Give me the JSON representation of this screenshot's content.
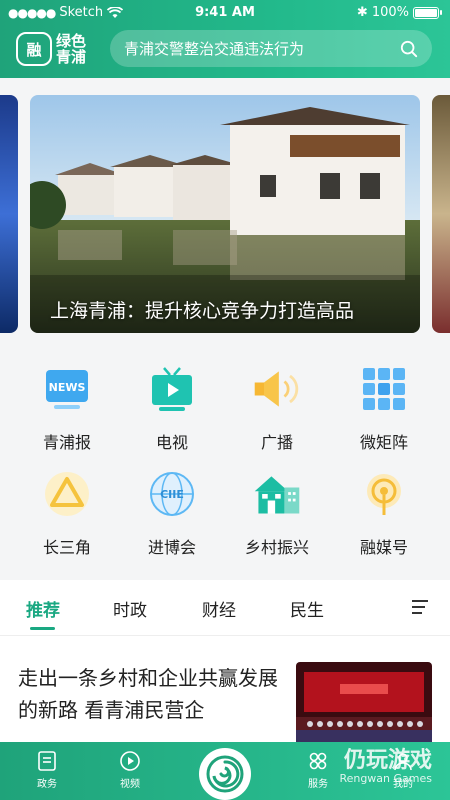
{
  "status_bar": {
    "carrier": "Sketch",
    "time": "9:41 AM",
    "battery": "100%"
  },
  "header": {
    "logo_text": "绿色青浦",
    "search_placeholder": "青浦交警整治交通违法行为"
  },
  "banner": {
    "caption": "上海青浦：提升核心竞争力打造高品"
  },
  "grid": [
    {
      "label": "青浦报",
      "icon": "news-icon"
    },
    {
      "label": "电视",
      "icon": "tv-icon"
    },
    {
      "label": "广播",
      "icon": "radio-icon"
    },
    {
      "label": "微矩阵",
      "icon": "matrix-icon"
    },
    {
      "label": "长三角",
      "icon": "delta-icon"
    },
    {
      "label": "进博会",
      "icon": "ciie-icon"
    },
    {
      "label": "乡村振兴",
      "icon": "village-icon"
    },
    {
      "label": "融媒号",
      "icon": "media-icon"
    }
  ],
  "tabs": [
    "推荐",
    "时政",
    "财经",
    "民生"
  ],
  "article": {
    "title": "走出一条乡村和企业共赢发展的新路 看青浦民营企"
  },
  "bottom_nav": [
    {
      "label": "政务",
      "icon": "document-icon"
    },
    {
      "label": "视频",
      "icon": "play-icon"
    },
    {
      "label": "服务",
      "icon": "services-icon"
    },
    {
      "label": "我的",
      "icon": "user-icon"
    }
  ],
  "watermark": {
    "main": "仍玩游戏",
    "sub": "Rengwan Games"
  },
  "colors": {
    "brand_green": "#1fa37a",
    "active_tab": "#1aa882"
  }
}
